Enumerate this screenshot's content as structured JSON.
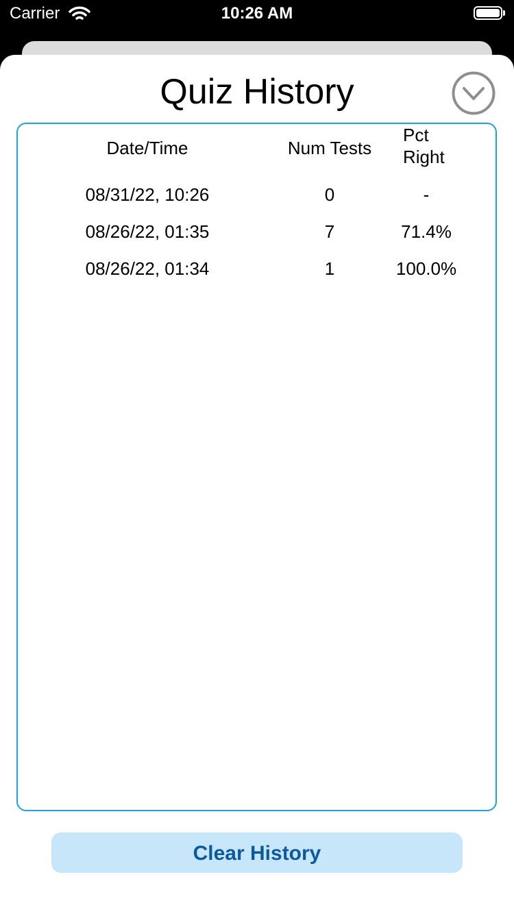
{
  "status_bar": {
    "carrier": "Carrier",
    "time": "10:26 AM"
  },
  "page": {
    "title": "Quiz History"
  },
  "table": {
    "columns": {
      "date": "Date/Time",
      "num": "Num Tests",
      "pct_line1": "Pct",
      "pct_line2": "Right"
    },
    "rows": [
      {
        "date": "08/31/22, 10:26",
        "num": "0",
        "pct": "-"
      },
      {
        "date": "08/26/22, 01:35",
        "num": "7",
        "pct": "71.4%"
      },
      {
        "date": "08/26/22, 01:34",
        "num": "1",
        "pct": "100.0%"
      }
    ]
  },
  "actions": {
    "clear_label": "Clear History"
  },
  "colors": {
    "accent_border": "#1aa3e0",
    "button_bg": "#c8e6fa",
    "button_text": "#0a5a9c"
  }
}
